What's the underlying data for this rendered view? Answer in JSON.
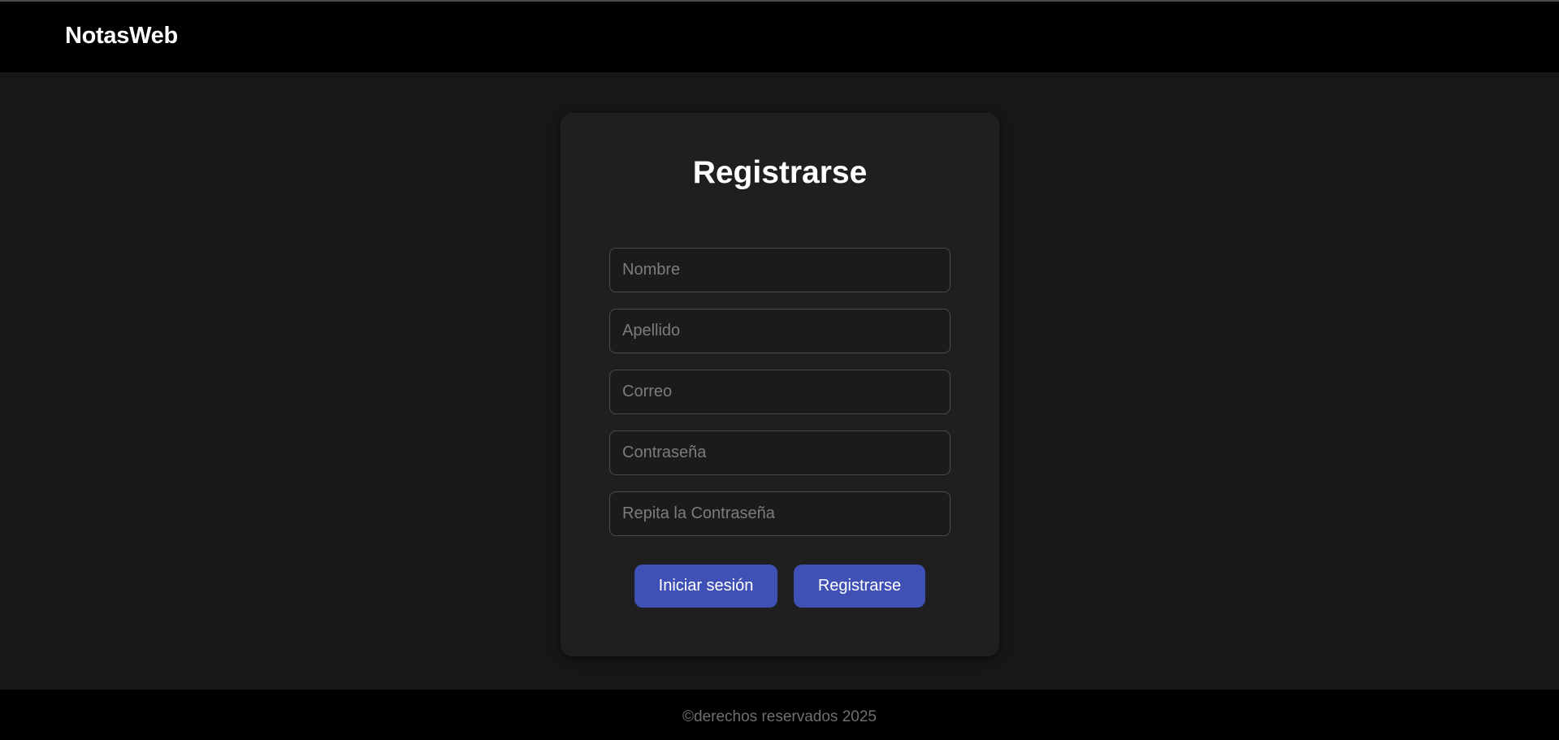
{
  "app": {
    "brand": "NotasWeb"
  },
  "form": {
    "title": "Registrarse",
    "fields": {
      "nombre": {
        "placeholder": "Nombre",
        "value": ""
      },
      "apellido": {
        "placeholder": "Apellido",
        "value": ""
      },
      "correo": {
        "placeholder": "Correo",
        "value": ""
      },
      "contrasena": {
        "placeholder": "Contraseña",
        "value": ""
      },
      "repetir": {
        "placeholder": "Repita la Contraseña",
        "value": ""
      }
    },
    "buttons": {
      "login_label": "Iniciar sesión",
      "register_label": "Registrarse"
    }
  },
  "footer": {
    "text": "©derechos reservados 2025"
  },
  "colors": {
    "background": "#171717",
    "navbar": "#000000",
    "card": "#1f1f1f",
    "accent": "#3f51b5",
    "placeholder": "#7c7c7c"
  }
}
